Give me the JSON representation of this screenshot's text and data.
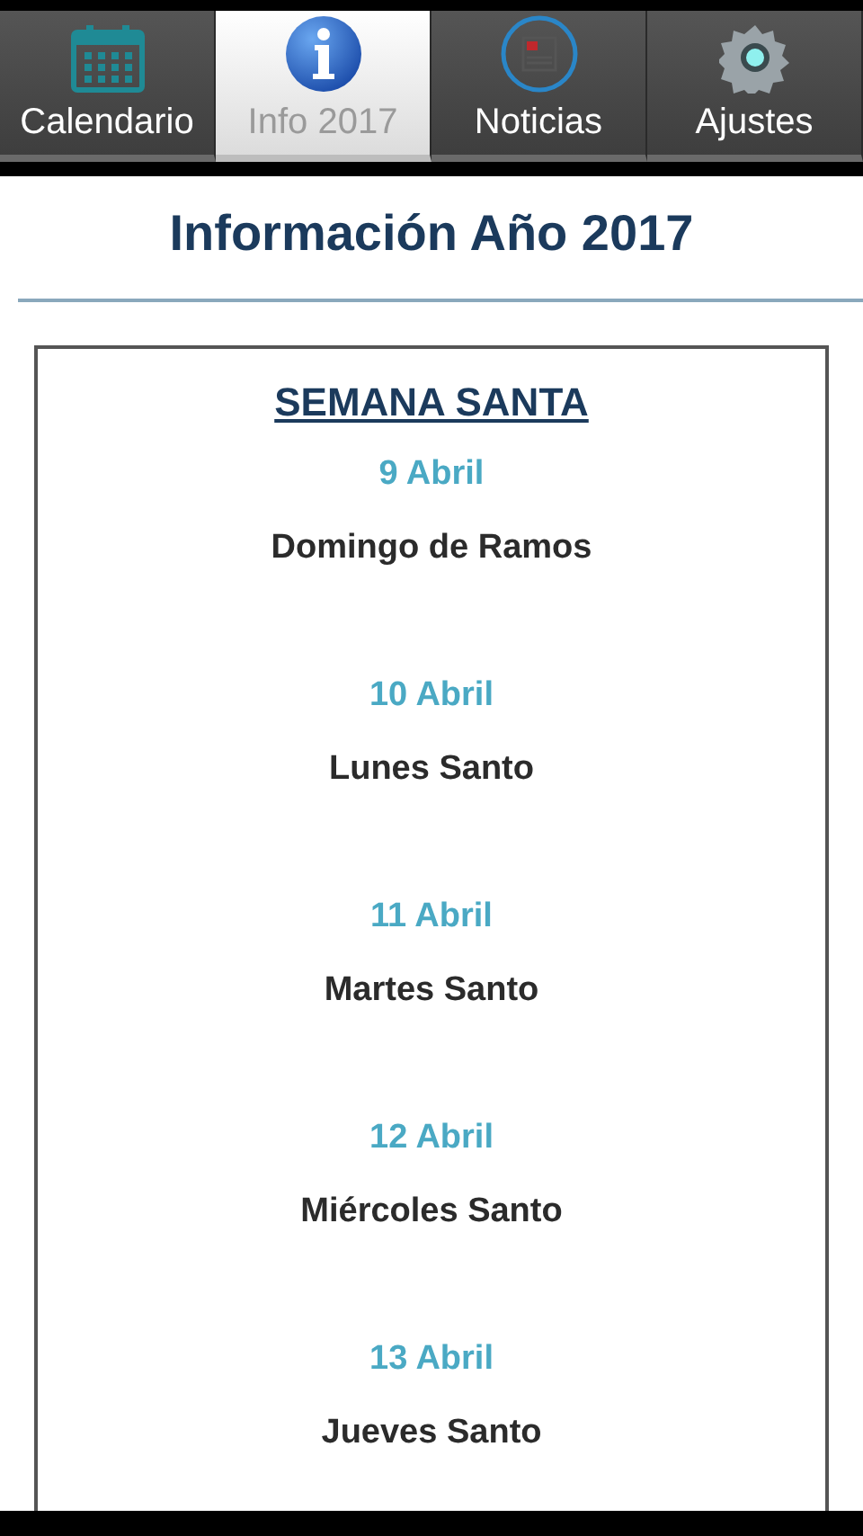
{
  "tabs": [
    {
      "label": "Calendario",
      "kind": "calendar",
      "selected": false
    },
    {
      "label": "Info 2017",
      "kind": "info",
      "selected": true
    },
    {
      "label": "Noticias",
      "kind": "news",
      "selected": false
    },
    {
      "label": "Ajustes",
      "kind": "settings",
      "selected": false
    }
  ],
  "title": "Información Año 2017",
  "section": {
    "heading": "SEMANA SANTA",
    "days": [
      {
        "date": "9 Abril",
        "name": "Domingo de Ramos"
      },
      {
        "date": "10 Abril",
        "name": "Lunes Santo"
      },
      {
        "date": "11 Abril",
        "name": "Martes Santo"
      },
      {
        "date": "12 Abril",
        "name": "Miércoles Santo"
      },
      {
        "date": "13 Abril",
        "name": "Jueves Santo"
      }
    ]
  }
}
